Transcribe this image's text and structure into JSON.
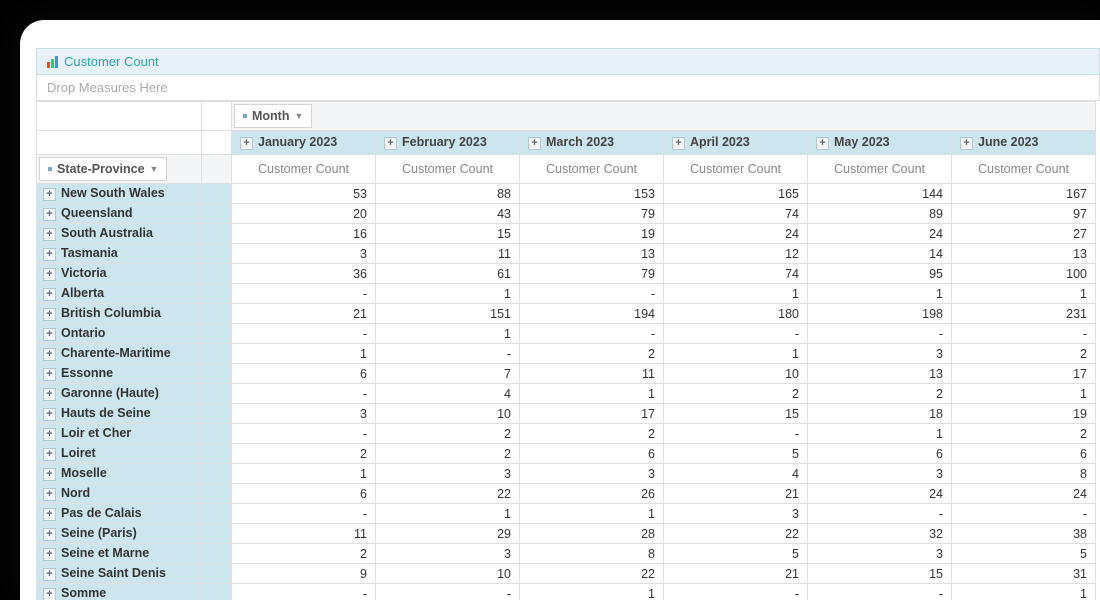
{
  "title": "Customer Count",
  "drop_hint": "Drop Measures Here",
  "col_field": "Month",
  "row_field": "State-Province",
  "measure_label": "Customer Count",
  "columns": [
    "January 2023",
    "February 2023",
    "March 2023",
    "April 2023",
    "May 2023",
    "June 2023"
  ],
  "rows": [
    {
      "label": "New South Wales",
      "v": [
        "53",
        "88",
        "153",
        "165",
        "144",
        "167"
      ]
    },
    {
      "label": "Queensland",
      "v": [
        "20",
        "43",
        "79",
        "74",
        "89",
        "97"
      ]
    },
    {
      "label": "South Australia",
      "v": [
        "16",
        "15",
        "19",
        "24",
        "24",
        "27"
      ]
    },
    {
      "label": "Tasmania",
      "v": [
        "3",
        "11",
        "13",
        "12",
        "14",
        "13"
      ]
    },
    {
      "label": "Victoria",
      "v": [
        "36",
        "61",
        "79",
        "74",
        "95",
        "100"
      ]
    },
    {
      "label": "Alberta",
      "v": [
        "-",
        "1",
        "-",
        "1",
        "1",
        "1"
      ]
    },
    {
      "label": "British Columbia",
      "v": [
        "21",
        "151",
        "194",
        "180",
        "198",
        "231"
      ]
    },
    {
      "label": "Ontario",
      "v": [
        "-",
        "1",
        "-",
        "-",
        "-",
        "-"
      ]
    },
    {
      "label": "Charente-Maritime",
      "v": [
        "1",
        "-",
        "2",
        "1",
        "3",
        "2"
      ]
    },
    {
      "label": "Essonne",
      "v": [
        "6",
        "7",
        "11",
        "10",
        "13",
        "17"
      ]
    },
    {
      "label": "Garonne (Haute)",
      "v": [
        "-",
        "4",
        "1",
        "2",
        "2",
        "1"
      ]
    },
    {
      "label": "Hauts de Seine",
      "v": [
        "3",
        "10",
        "17",
        "15",
        "18",
        "19"
      ]
    },
    {
      "label": "Loir et Cher",
      "v": [
        "-",
        "2",
        "2",
        "-",
        "1",
        "2"
      ]
    },
    {
      "label": "Loiret",
      "v": [
        "2",
        "2",
        "6",
        "5",
        "6",
        "6"
      ]
    },
    {
      "label": "Moselle",
      "v": [
        "1",
        "3",
        "3",
        "4",
        "3",
        "8"
      ]
    },
    {
      "label": "Nord",
      "v": [
        "6",
        "22",
        "26",
        "21",
        "24",
        "24"
      ]
    },
    {
      "label": "Pas de Calais",
      "v": [
        "-",
        "1",
        "1",
        "3",
        "-",
        "-"
      ]
    },
    {
      "label": "Seine (Paris)",
      "v": [
        "11",
        "29",
        "28",
        "22",
        "32",
        "38"
      ]
    },
    {
      "label": "Seine et Marne",
      "v": [
        "2",
        "3",
        "8",
        "5",
        "3",
        "5"
      ]
    },
    {
      "label": "Seine Saint Denis",
      "v": [
        "9",
        "10",
        "22",
        "21",
        "15",
        "31"
      ]
    },
    {
      "label": "Somme",
      "v": [
        "-",
        "-",
        "1",
        "-",
        "-",
        "1"
      ]
    }
  ],
  "chart_data": {
    "type": "table",
    "title": "Customer Count",
    "xlabel": "Month",
    "ylabel": "State-Province",
    "categories": [
      "January 2023",
      "February 2023",
      "March 2023",
      "April 2023",
      "May 2023",
      "June 2023"
    ],
    "series": [
      {
        "name": "New South Wales",
        "values": [
          53,
          88,
          153,
          165,
          144,
          167
        ]
      },
      {
        "name": "Queensland",
        "values": [
          20,
          43,
          79,
          74,
          89,
          97
        ]
      },
      {
        "name": "South Australia",
        "values": [
          16,
          15,
          19,
          24,
          24,
          27
        ]
      },
      {
        "name": "Tasmania",
        "values": [
          3,
          11,
          13,
          12,
          14,
          13
        ]
      },
      {
        "name": "Victoria",
        "values": [
          36,
          61,
          79,
          74,
          95,
          100
        ]
      },
      {
        "name": "Alberta",
        "values": [
          null,
          1,
          null,
          1,
          1,
          1
        ]
      },
      {
        "name": "British Columbia",
        "values": [
          21,
          151,
          194,
          180,
          198,
          231
        ]
      },
      {
        "name": "Ontario",
        "values": [
          null,
          1,
          null,
          null,
          null,
          null
        ]
      },
      {
        "name": "Charente-Maritime",
        "values": [
          1,
          null,
          2,
          1,
          3,
          2
        ]
      },
      {
        "name": "Essonne",
        "values": [
          6,
          7,
          11,
          10,
          13,
          17
        ]
      },
      {
        "name": "Garonne (Haute)",
        "values": [
          null,
          4,
          1,
          2,
          2,
          1
        ]
      },
      {
        "name": "Hauts de Seine",
        "values": [
          3,
          10,
          17,
          15,
          18,
          19
        ]
      },
      {
        "name": "Loir et Cher",
        "values": [
          null,
          2,
          2,
          null,
          1,
          2
        ]
      },
      {
        "name": "Loiret",
        "values": [
          2,
          2,
          6,
          5,
          6,
          6
        ]
      },
      {
        "name": "Moselle",
        "values": [
          1,
          3,
          3,
          4,
          3,
          8
        ]
      },
      {
        "name": "Nord",
        "values": [
          6,
          22,
          26,
          21,
          24,
          24
        ]
      },
      {
        "name": "Pas de Calais",
        "values": [
          null,
          1,
          1,
          3,
          null,
          null
        ]
      },
      {
        "name": "Seine (Paris)",
        "values": [
          11,
          29,
          28,
          22,
          32,
          38
        ]
      },
      {
        "name": "Seine et Marne",
        "values": [
          2,
          3,
          8,
          5,
          3,
          5
        ]
      },
      {
        "name": "Seine Saint Denis",
        "values": [
          9,
          10,
          22,
          21,
          15,
          31
        ]
      },
      {
        "name": "Somme",
        "values": [
          null,
          null,
          1,
          null,
          null,
          1
        ]
      }
    ]
  }
}
